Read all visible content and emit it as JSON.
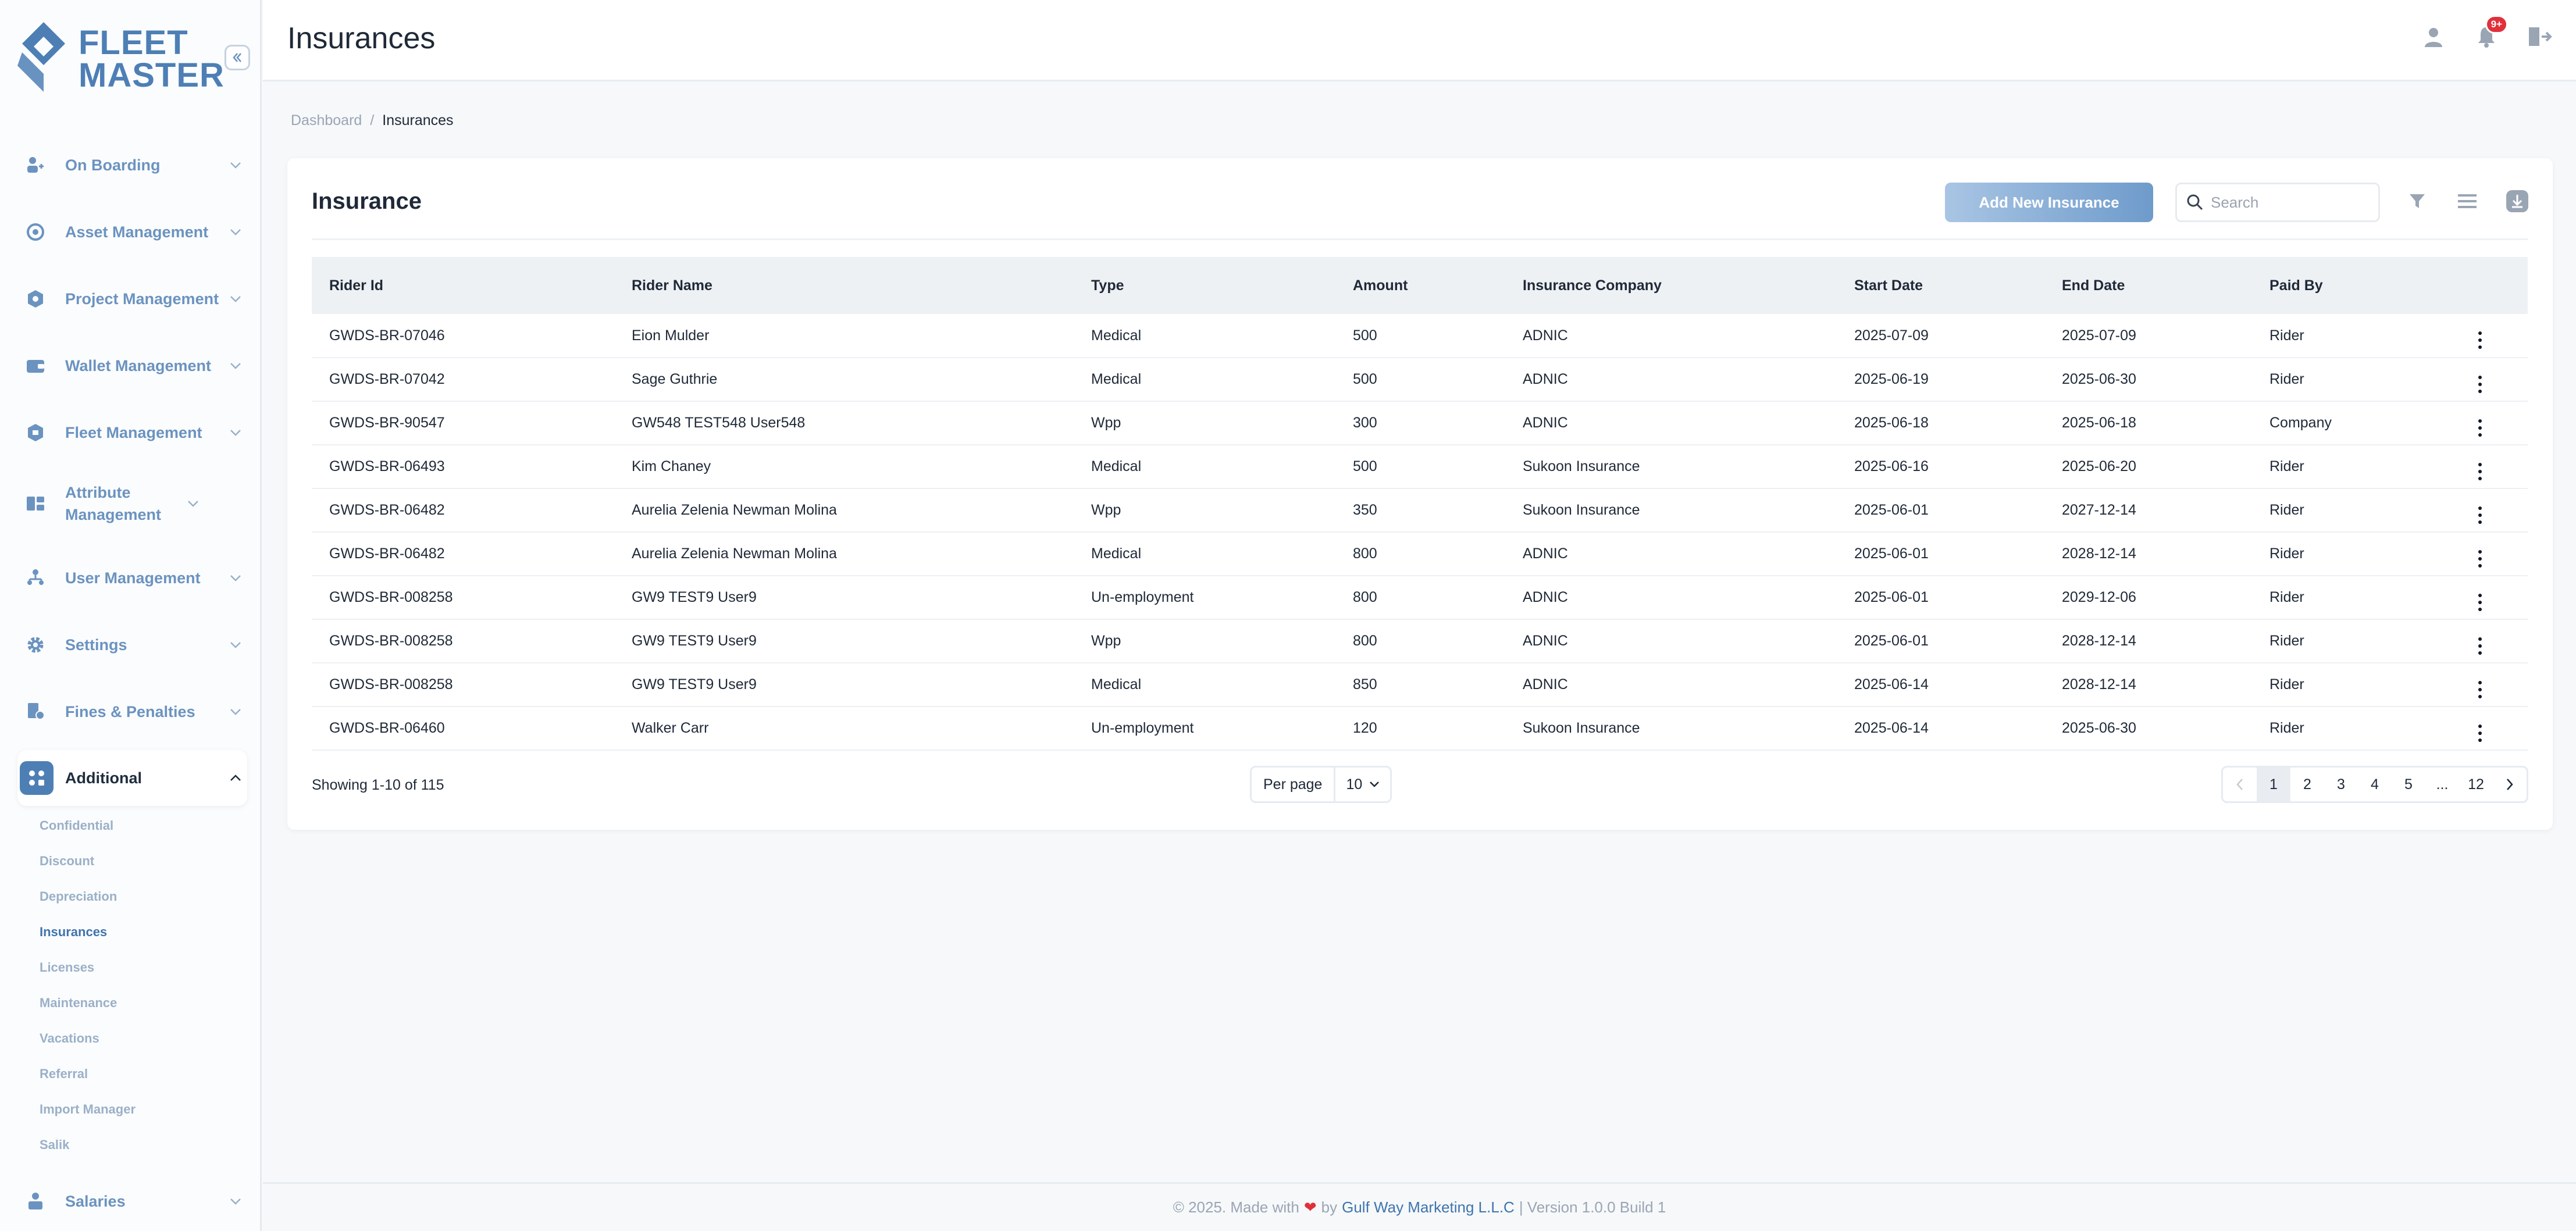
{
  "brand": {
    "line1": "FLEET",
    "line2": "MASTER"
  },
  "sidebar": {
    "items": [
      {
        "label": "On Boarding",
        "icon": "onboarding-icon"
      },
      {
        "label": "Asset Management",
        "icon": "asset-icon"
      },
      {
        "label": "Project Management",
        "icon": "project-icon"
      },
      {
        "label": "Wallet Management",
        "icon": "wallet-icon"
      },
      {
        "label": "Fleet Management",
        "icon": "fleet-icon"
      },
      {
        "label": "Attribute Management",
        "icon": "attribute-icon"
      },
      {
        "label": "User Management",
        "icon": "users-icon"
      },
      {
        "label": "Settings",
        "icon": "gear-icon"
      },
      {
        "label": "Fines & Penalties",
        "icon": "fines-icon"
      },
      {
        "label": "Additional",
        "icon": "additional-icon"
      },
      {
        "label": "Salaries",
        "icon": "salaries-icon"
      }
    ],
    "subitems": [
      "Confidential",
      "Discount",
      "Depreciation",
      "Insurances",
      "Licenses",
      "Maintenance",
      "Vacations",
      "Referral",
      "Import Manager",
      "Salik"
    ]
  },
  "header": {
    "title": "Insurances",
    "notification_count": "9+"
  },
  "breadcrumb": {
    "root": "Dashboard",
    "sep": "/",
    "current": "Insurances"
  },
  "card": {
    "title": "Insurance",
    "add_button": "Add New Insurance",
    "search_placeholder": "Search"
  },
  "table": {
    "columns": [
      "Rider Id",
      "Rider Name",
      "Type",
      "Amount",
      "Insurance Company",
      "Start Date",
      "End Date",
      "Paid By"
    ],
    "rows": [
      [
        "GWDS-BR-07046",
        "Eion Mulder",
        "Medical",
        "500",
        "ADNIC",
        "2025-07-09",
        "2025-07-09",
        "Rider"
      ],
      [
        "GWDS-BR-07042",
        "Sage Guthrie",
        "Medical",
        "500",
        "ADNIC",
        "2025-06-19",
        "2025-06-30",
        "Rider"
      ],
      [
        "GWDS-BR-90547",
        "GW548 TEST548 User548",
        "Wpp",
        "300",
        "ADNIC",
        "2025-06-18",
        "2025-06-18",
        "Company"
      ],
      [
        "GWDS-BR-06493",
        "Kim Chaney",
        "Medical",
        "500",
        "Sukoon Insurance",
        "2025-06-16",
        "2025-06-20",
        "Rider"
      ],
      [
        "GWDS-BR-06482",
        "Aurelia Zelenia Newman Molina",
        "Wpp",
        "350",
        "Sukoon Insurance",
        "2025-06-01",
        "2027-12-14",
        "Rider"
      ],
      [
        "GWDS-BR-06482",
        "Aurelia Zelenia Newman Molina",
        "Medical",
        "800",
        "ADNIC",
        "2025-06-01",
        "2028-12-14",
        "Rider"
      ],
      [
        "GWDS-BR-008258",
        "GW9 TEST9 User9",
        "Un-employment",
        "800",
        "ADNIC",
        "2025-06-01",
        "2029-12-06",
        "Rider"
      ],
      [
        "GWDS-BR-008258",
        "GW9 TEST9 User9",
        "Wpp",
        "800",
        "ADNIC",
        "2025-06-01",
        "2028-12-14",
        "Rider"
      ],
      [
        "GWDS-BR-008258",
        "GW9 TEST9 User9",
        "Medical",
        "850",
        "ADNIC",
        "2025-06-14",
        "2028-12-14",
        "Rider"
      ],
      [
        "GWDS-BR-06460",
        "Walker Carr",
        "Un-employment",
        "120",
        "Sukoon Insurance",
        "2025-06-14",
        "2025-06-30",
        "Rider"
      ]
    ]
  },
  "pagination": {
    "showing": "Showing 1-10 of 115",
    "per_page_label": "Per page",
    "per_page_value": "10",
    "pages": [
      "1",
      "2",
      "3",
      "4",
      "5",
      "...",
      "12"
    ],
    "active": "1"
  },
  "footer": {
    "prefix": "© 2025. Made with",
    "by": "by",
    "company": "Gulf Way Marketing L.L.C",
    "suffix": "| Version 1.0.0 Build 1"
  },
  "colors": {
    "brand": "#4d7fb5",
    "accent": "#3f74ad",
    "badge": "#e0313b"
  }
}
